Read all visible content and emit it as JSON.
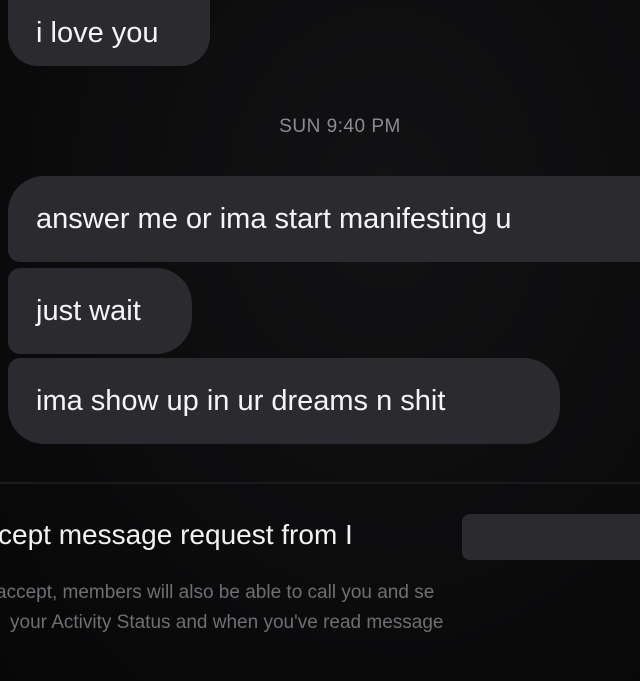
{
  "thread": {
    "messages": [
      {
        "text": "i love you"
      },
      {
        "text": "answer me or ima start manifesting u"
      },
      {
        "text": "just wait"
      },
      {
        "text": "ima show up in ur dreams n shit"
      }
    ],
    "timestamp": "SUN 9:40 PM"
  },
  "request": {
    "title": "cept message request from I",
    "info_line1": "accept, members will also be able to call you and se",
    "info_line2": "your Activity Status and when you've read message"
  },
  "colors": {
    "background": "#0b0b0c",
    "bubble": "#2b2a2f",
    "timestamp": "#8b8b90",
    "info_text": "#6f6f73"
  }
}
